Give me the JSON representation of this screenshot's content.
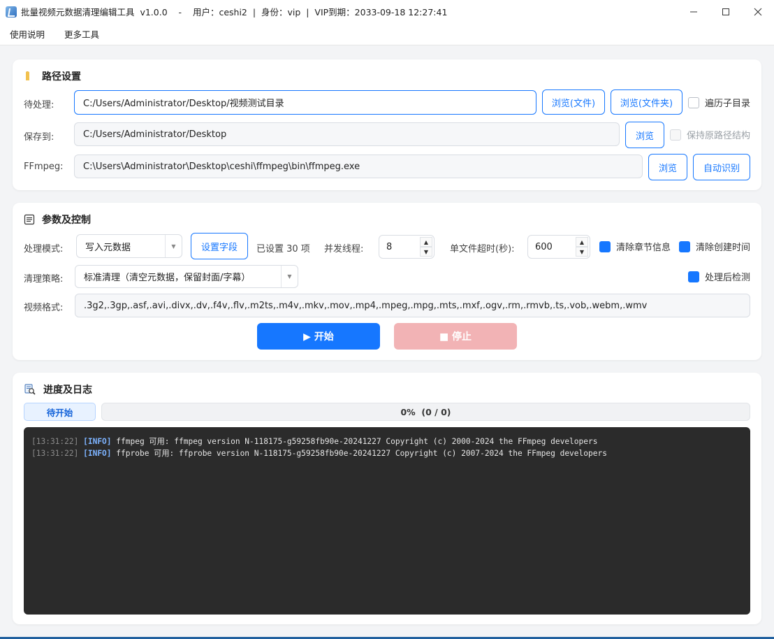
{
  "window": {
    "title": "批量视频元数据清理编辑工具  v1.0.0    -    用户：ceshi2  |  身份：vip  |  VIP到期：2033-09-18 12:27:41"
  },
  "menu": [
    "使用说明",
    "更多工具"
  ],
  "path_section": {
    "title": "路径设置",
    "input_label": "待处理:",
    "input_value": "C:/Users/Administrator/Desktop/视频测试目录",
    "browse_file": "浏览(文件)",
    "browse_folder": "浏览(文件夹)",
    "recursive_label": "遍历子目录",
    "output_label": "保存到:",
    "output_value": "C:/Users/Administrator/Desktop",
    "browse": "浏览",
    "keep_structure_label": "保持原路径结构",
    "ffmpeg_label": "FFmpeg:",
    "ffmpeg_value": "C:\\Users\\Administrator\\Desktop\\ceshi\\ffmpeg\\bin\\ffmpeg.exe",
    "auto_detect": "自动识别"
  },
  "params_section": {
    "title": "参数及控制",
    "mode_label": "处理模式:",
    "mode_value": "写入元数据",
    "set_fields": "设置字段",
    "fields_count": "已设置 30 项",
    "threads_label": "并发线程:",
    "threads_value": "8",
    "timeout_label": "单文件超时(秒):",
    "timeout_value": "600",
    "clear_chapters": "清除章节信息",
    "clear_creation_time": "清除创建时间",
    "strategy_label": "清理策略:",
    "strategy_value": "标准清理（清空元数据，保留封面/字幕）",
    "post_check": "处理后检测",
    "formats_label": "视频格式:",
    "formats_value": ".3g2,.3gp,.asf,.avi,.divx,.dv,.f4v,.flv,.m2ts,.m4v,.mkv,.mov,.mp4,.mpeg,.mpg,.mts,.mxf,.ogv,.rm,.rmvb,.ts,.vob,.webm,.wmv",
    "start": "▶ 开始",
    "stop": "■ 停止"
  },
  "log_section": {
    "title": "进度及日志",
    "status": "待开始",
    "progress_fraction": 0,
    "progress_text": "0%  (0 / 0)",
    "lines": [
      {
        "time": "[13:31:22]",
        "level": "[INFO]",
        "msg": "ffmpeg 可用: ffmpeg version N-118175-g59258fb90e-20241227 Copyright (c) 2000-2024 the FFmpeg developers"
      },
      {
        "time": "[13:31:22]",
        "level": "[INFO]",
        "msg": "ffprobe 可用: ffprobe version N-118175-g59258fb90e-20241227 Copyright (c) 2007-2024 the FFmpeg developers"
      }
    ]
  },
  "colors": {
    "accent": "#1677ff",
    "stop_disabled": "#f2b3b5",
    "log_bg": "#2b2b2b"
  }
}
